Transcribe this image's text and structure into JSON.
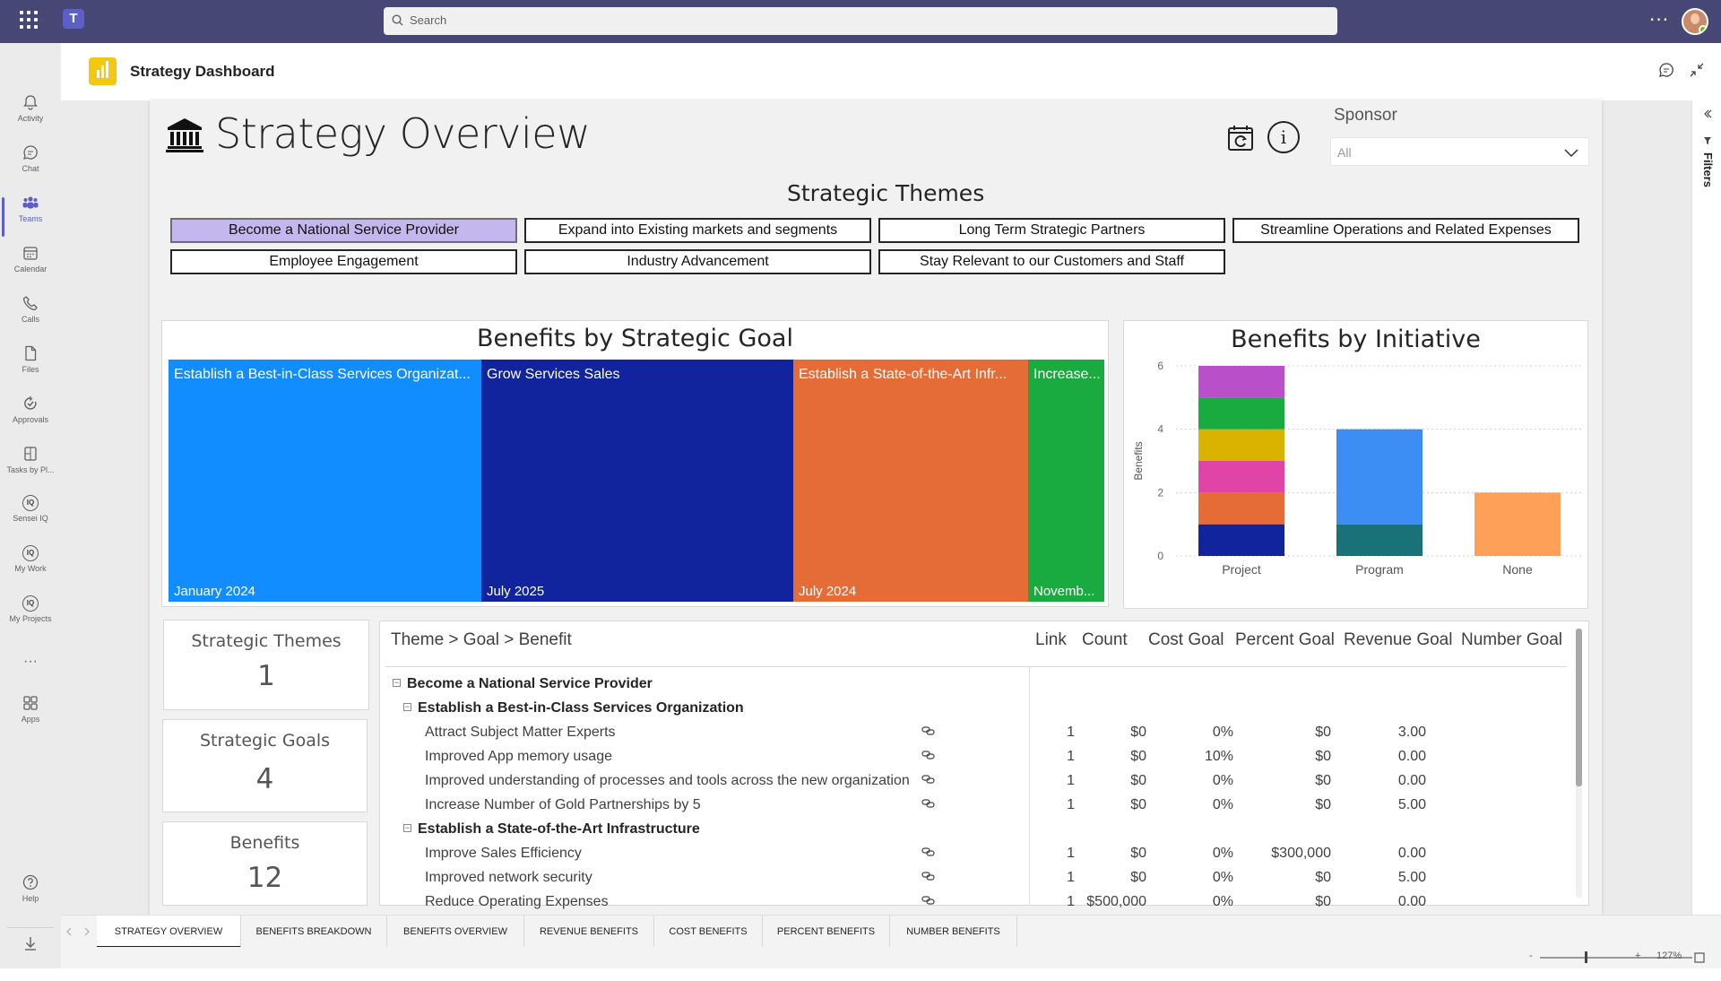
{
  "shell": {
    "search_placeholder": "Search",
    "more_label": "···",
    "app_title": "Strategy Dashboard"
  },
  "rail": {
    "items": [
      {
        "label": "Activity",
        "icon": "bell-icon"
      },
      {
        "label": "Chat",
        "icon": "chat-icon"
      },
      {
        "label": "Teams",
        "icon": "teams-icon"
      },
      {
        "label": "Calendar",
        "icon": "calendar-icon"
      },
      {
        "label": "Calls",
        "icon": "phone-icon"
      },
      {
        "label": "Files",
        "icon": "file-icon"
      },
      {
        "label": "Approvals",
        "icon": "approvals-icon"
      },
      {
        "label": "Tasks by Pl...",
        "icon": "tasks-icon"
      },
      {
        "label": "Sensei IQ",
        "icon": "iq-icon"
      },
      {
        "label": "My Work",
        "icon": "iq-icon"
      },
      {
        "label": "My Projects",
        "icon": "iq-icon"
      },
      {
        "label": "Apps",
        "icon": "apps-icon"
      },
      {
        "label": "Help",
        "icon": "help-icon"
      }
    ],
    "more": "···",
    "iq": "IQ"
  },
  "report": {
    "title": "Strategy Overview",
    "info_symbol": "i",
    "sponsor_label": "Sponsor",
    "sponsor_value": "All",
    "themes_title": "Strategic Themes",
    "themes": [
      "Become a National Service Provider",
      "Expand into Existing markets and segments",
      "Long Term Strategic Partners",
      "Streamline Operations and Related Expenses",
      "Employee Engagement",
      "Industry Advancement",
      "Stay Relevant to our Customers and Staff"
    ],
    "selected_theme": "Become a National Service Provider",
    "treemap_title": "Benefits by Strategic Goal",
    "treemap": [
      {
        "label": "Establish a Best-in-Class Services Organizat...",
        "date": "January 2024",
        "color": "#118dff"
      },
      {
        "label": "Grow Services Sales",
        "date": "July 2025",
        "color": "#12239e"
      },
      {
        "label": "Establish a State-of-the-Art Infr...",
        "date": "July 2024",
        "color": "#e66c37"
      },
      {
        "label": "Increase...",
        "date": "Novemb...",
        "color": "#1aab40"
      }
    ],
    "kpis": [
      {
        "label": "Strategic Themes",
        "value": "1"
      },
      {
        "label": "Strategic Goals",
        "value": "4"
      },
      {
        "label": "Benefits",
        "value": "12"
      }
    ],
    "table": {
      "headers": [
        "Theme > Goal > Benefit",
        "Link",
        "Count",
        "Cost Goal",
        "Percent Goal",
        "Revenue Goal",
        "Number Goal"
      ],
      "rows": [
        {
          "level": 0,
          "label": "Become a National Service Provider"
        },
        {
          "level": 1,
          "label": "Establish a Best-in-Class Services Organization"
        },
        {
          "level": 2,
          "label": "Attract Subject Matter Experts",
          "count": "1",
          "cost": "$0",
          "percent": "0%",
          "revenue": "$0",
          "number": "3.00"
        },
        {
          "level": 2,
          "label": "Improved App memory usage",
          "count": "1",
          "cost": "$0",
          "percent": "10%",
          "revenue": "$0",
          "number": "0.00"
        },
        {
          "level": 2,
          "label": "Improved understanding of processes and tools across the new organization",
          "count": "1",
          "cost": "$0",
          "percent": "0%",
          "revenue": "$0",
          "number": "0.00"
        },
        {
          "level": 2,
          "label": "Increase Number of Gold Partnerships by 5",
          "count": "1",
          "cost": "$0",
          "percent": "0%",
          "revenue": "$0",
          "number": "5.00"
        },
        {
          "level": 1,
          "label": "Establish a State-of-the-Art Infrastructure"
        },
        {
          "level": 2,
          "label": "Improve Sales Efficiency",
          "count": "1",
          "cost": "$0",
          "percent": "0%",
          "revenue": "$300,000",
          "number": "0.00"
        },
        {
          "level": 2,
          "label": "Improved network security",
          "count": "1",
          "cost": "$0",
          "percent": "0%",
          "revenue": "$0",
          "number": "5.00"
        },
        {
          "level": 2,
          "label": "Reduce Operating Expenses",
          "count": "1",
          "cost": "$500,000",
          "percent": "0%",
          "revenue": "$0",
          "number": "0.00"
        }
      ]
    },
    "filters_label": "Filters"
  },
  "chart_data": {
    "type": "bar",
    "title": "Benefits by Initiative",
    "ylabel": "Benefits",
    "xlabel": "",
    "ylim": [
      0,
      6
    ],
    "yticks": [
      "0",
      "2",
      "4",
      "6"
    ],
    "categories": [
      "Project",
      "Program",
      "None"
    ],
    "stacked": true,
    "segments": [
      [
        {
          "value": 1,
          "color": "#12239e"
        },
        {
          "value": 1,
          "color": "#e66c37"
        },
        {
          "value": 1,
          "color": "#e044a7"
        },
        {
          "value": 1,
          "color": "#d9b300"
        },
        {
          "value": 1,
          "color": "#1aab40"
        },
        {
          "value": 1,
          "color": "#b94fc9"
        }
      ],
      [
        {
          "value": 1,
          "color": "#197278"
        },
        {
          "value": 3,
          "color": "#3c8ef5"
        }
      ],
      [
        {
          "value": 2,
          "color": "#ffa058"
        }
      ]
    ]
  },
  "tabs": [
    "STRATEGY OVERVIEW",
    "BENEFITS BREAKDOWN",
    "BENEFITS OVERVIEW",
    "REVENUE BENEFITS",
    "COST BENEFITS",
    "PERCENT BENEFITS",
    "NUMBER BENEFITS"
  ],
  "status": {
    "zoom": "127%",
    "minus": "-",
    "plus": "+"
  }
}
